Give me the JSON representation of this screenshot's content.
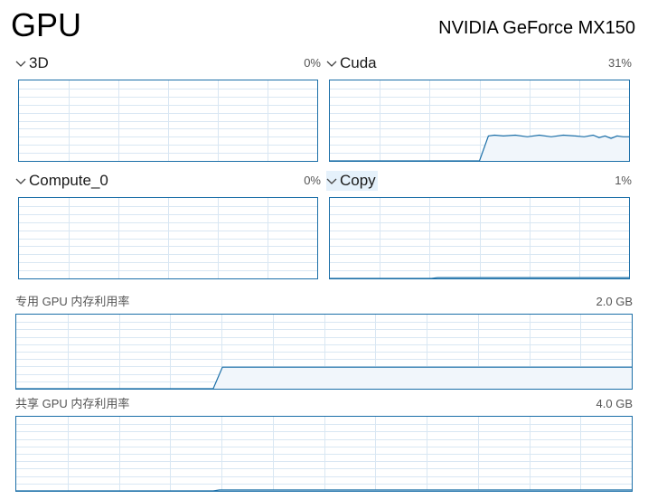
{
  "header": {
    "title": "GPU",
    "device_name": "NVIDIA GeForce MX150"
  },
  "engines": [
    {
      "name": "3D",
      "percent": "0%",
      "highlighted": false,
      "usage": []
    },
    {
      "name": "Cuda",
      "percent": "31%",
      "highlighted": false,
      "usage": [
        [
          0.0,
          0
        ],
        [
          0.5,
          0
        ],
        [
          0.53,
          0.31
        ],
        [
          0.55,
          0.32
        ],
        [
          0.58,
          0.31
        ],
        [
          0.62,
          0.32
        ],
        [
          0.66,
          0.3
        ],
        [
          0.7,
          0.32
        ],
        [
          0.74,
          0.3
        ],
        [
          0.78,
          0.32
        ],
        [
          0.82,
          0.31
        ],
        [
          0.85,
          0.3
        ],
        [
          0.88,
          0.32
        ],
        [
          0.9,
          0.29
        ],
        [
          0.92,
          0.31
        ],
        [
          0.94,
          0.28
        ],
        [
          0.96,
          0.31
        ],
        [
          0.98,
          0.3
        ],
        [
          1.0,
          0.3
        ]
      ]
    },
    {
      "name": "Compute_0",
      "percent": "0%",
      "highlighted": false,
      "usage": []
    },
    {
      "name": "Copy",
      "percent": "1%",
      "highlighted": true,
      "usage": [
        [
          0.0,
          0
        ],
        [
          0.34,
          0
        ],
        [
          0.36,
          0.01
        ],
        [
          1.0,
          0.01
        ]
      ]
    }
  ],
  "memory": [
    {
      "label": "专用 GPU 内存利用率",
      "max": "2.0 GB",
      "usage": [
        [
          0.0,
          0
        ],
        [
          0.32,
          0
        ],
        [
          0.335,
          0.29
        ],
        [
          1.0,
          0.29
        ]
      ]
    },
    {
      "label": "共享 GPU 内存利用率",
      "max": "4.0 GB",
      "usage": [
        [
          0.0,
          0
        ],
        [
          0.32,
          0
        ],
        [
          0.33,
          0.012
        ],
        [
          1.0,
          0.012
        ]
      ]
    }
  ],
  "colors": {
    "line": "#1b6fa8",
    "fill": "#f1f6fb",
    "grid": "#d9e7f3",
    "highlight": "#e5f1fb"
  }
}
